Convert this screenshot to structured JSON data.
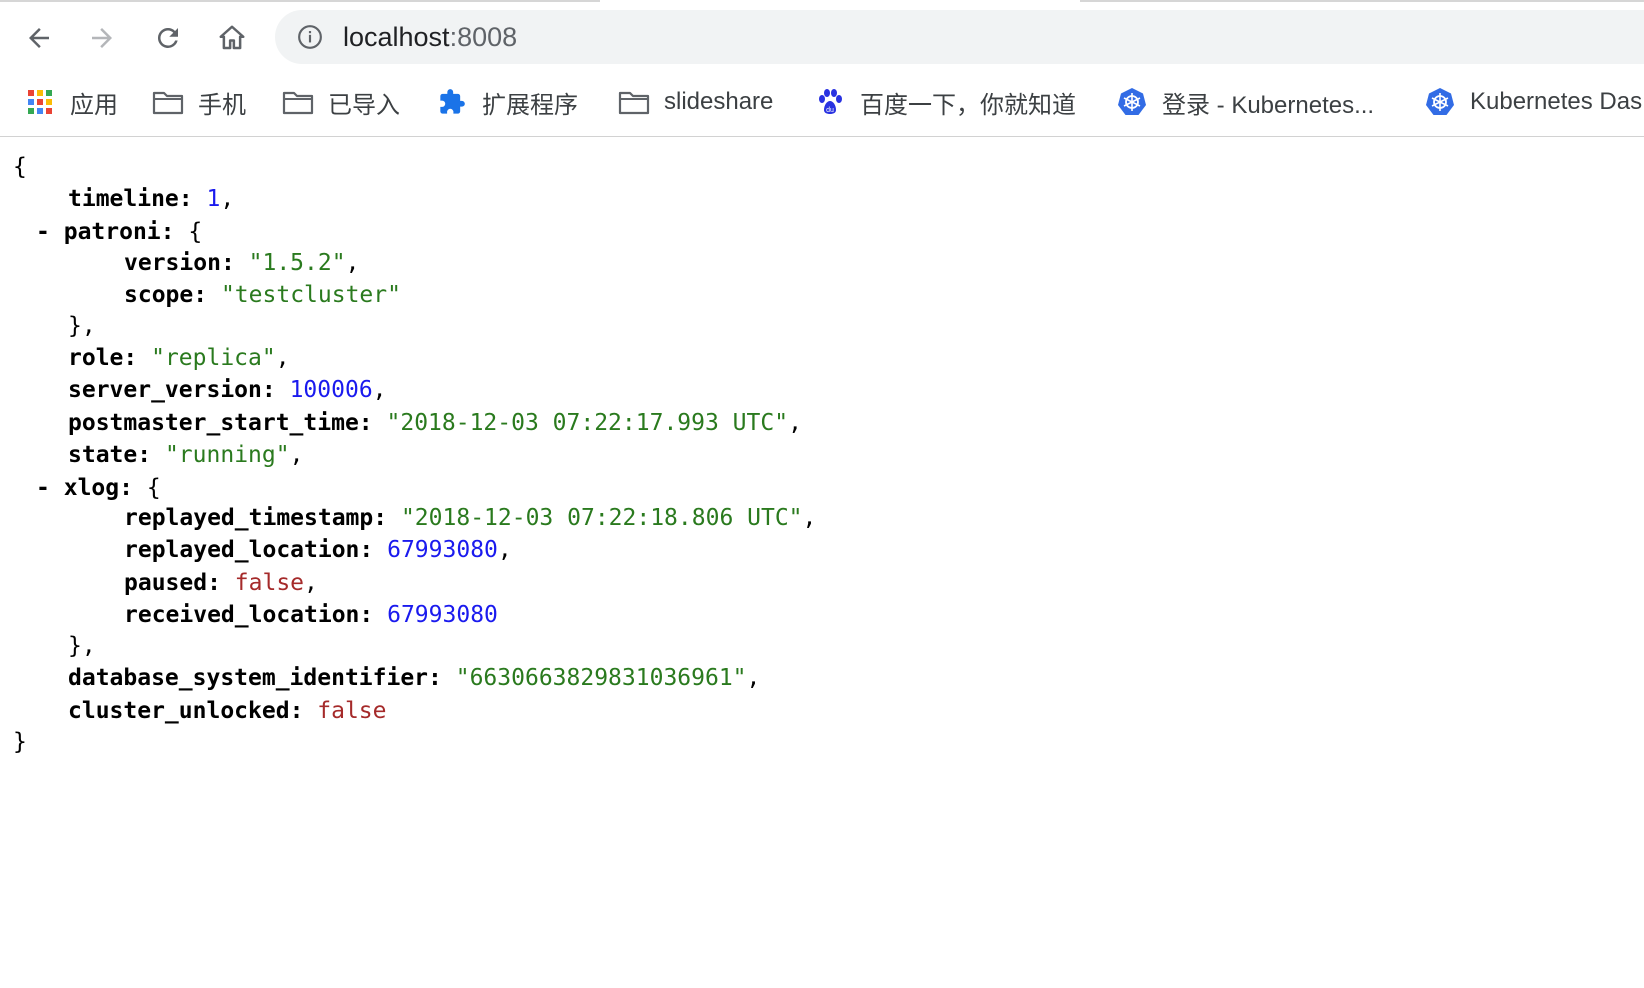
{
  "browser": {
    "url_host": "localhost",
    "url_port": ":8008",
    "nav": {
      "back_icon": "arrow-left-icon",
      "forward_icon": "arrow-right-icon",
      "reload_icon": "reload-icon",
      "home_icon": "home-icon",
      "info_icon": "info-icon"
    },
    "bookmarks": [
      {
        "label": "应用",
        "icon": "apps-grid-icon"
      },
      {
        "label": "手机",
        "icon": "folder-icon"
      },
      {
        "label": "已导入",
        "icon": "folder-icon"
      },
      {
        "label": "扩展程序",
        "icon": "puzzle-icon"
      },
      {
        "label": "slideshare",
        "icon": "folder-icon"
      },
      {
        "label": "百度一下，你就知道",
        "icon": "baidu-paw-icon"
      },
      {
        "label": "登录 - Kubernetes...",
        "icon": "kubernetes-icon"
      },
      {
        "label": "Kubernetes Das",
        "icon": "kubernetes-icon"
      }
    ]
  },
  "json": {
    "open_brace": "{",
    "close_brace": "}",
    "collapse_marker": "-",
    "timeline": {
      "key": "timeline",
      "value": "1"
    },
    "patroni": {
      "key": "patroni",
      "version": {
        "key": "version",
        "value": "\"1.5.2\""
      },
      "scope": {
        "key": "scope",
        "value": "\"testcluster\""
      }
    },
    "role": {
      "key": "role",
      "value": "\"replica\""
    },
    "server_version": {
      "key": "server_version",
      "value": "100006"
    },
    "postmaster_start_time": {
      "key": "postmaster_start_time",
      "value": "\"2018-12-03 07:22:17.993 UTC\""
    },
    "state": {
      "key": "state",
      "value": "\"running\""
    },
    "xlog": {
      "key": "xlog",
      "replayed_timestamp": {
        "key": "replayed_timestamp",
        "value": "\"2018-12-03 07:22:18.806 UTC\""
      },
      "replayed_location": {
        "key": "replayed_location",
        "value": "67993080"
      },
      "paused": {
        "key": "paused",
        "value": "false"
      },
      "received_location": {
        "key": "received_location",
        "value": "67993080"
      }
    },
    "database_system_identifier": {
      "key": "database_system_identifier",
      "value": "\"6630663829831036961\""
    },
    "cluster_unlocked": {
      "key": "cluster_unlocked",
      "value": "false"
    }
  },
  "colors": {
    "string": "#2a7a1e",
    "number": "#1a1aee",
    "boolean": "#a52a2a",
    "omnibox_bg": "#f1f3f4"
  }
}
